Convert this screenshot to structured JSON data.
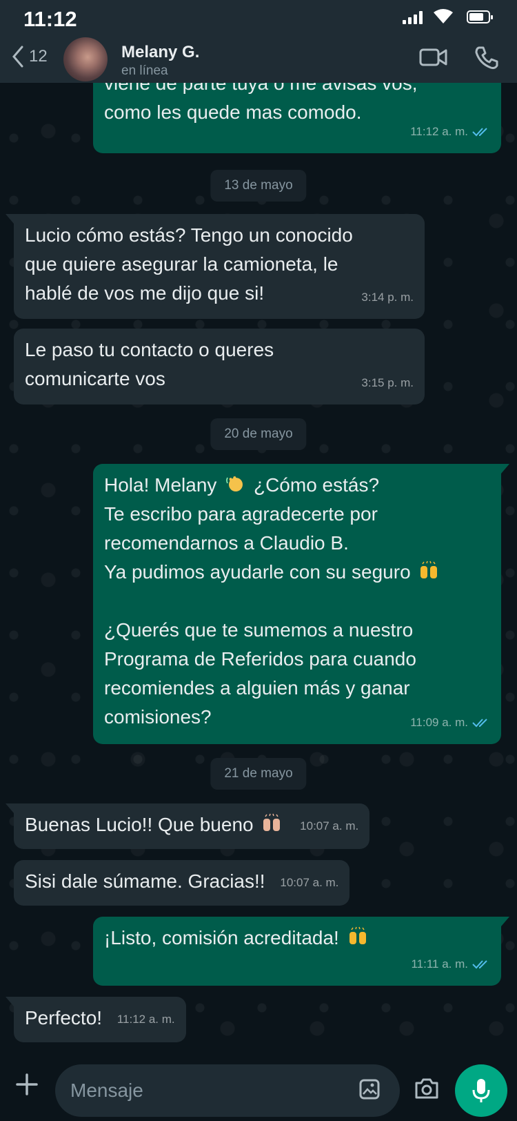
{
  "status_bar": {
    "time": "11:12"
  },
  "header": {
    "back_count": "12",
    "contact_name": "Melany G.",
    "contact_status": "en línea"
  },
  "dates": {
    "d1": "13 de mayo",
    "d2": "20 de mayo",
    "d3": "21 de mayo"
  },
  "messages": {
    "m0": {
      "lines": [
        "viene de parte tuya o me avisas vos,",
        "como les quede mas comodo."
      ],
      "time": "11:12 a. m."
    },
    "m1": {
      "lines": [
        "Lucio cómo estás? Tengo un conocido",
        "que quiere asegurar la camioneta, le",
        "hablé de vos me dijo que si!"
      ],
      "time": "3:14 p. m."
    },
    "m2": {
      "lines": [
        "Le paso tu contacto o queres",
        "comunicarte vos"
      ],
      "time": "3:15 p. m."
    },
    "m3": {
      "line1_a": "Hola! Melany",
      "line1_b": "¿Cómo estás?",
      "line2": "Te escribo para agradecerte por",
      "line3": "recomendarnos a Claudio B.",
      "line4": "Ya pudimos ayudarle con su seguro",
      "line5": "¿Querés que te sumemos a nuestro",
      "line6": "Programa de Referidos para cuando",
      "line7": "recomiendes a alguien más y ganar",
      "line8": "comisiones?",
      "time": "11:09 a. m."
    },
    "m4": {
      "text": "Buenas Lucio!! Que bueno",
      "time": "10:07 a. m."
    },
    "m5": {
      "text": "Sisi dale súmame. Gracias!!",
      "time": "10:07 a. m."
    },
    "m6": {
      "text": "¡Listo, comisión acreditada!",
      "time": "11:11 a. m."
    },
    "m7": {
      "text": "Perfecto!",
      "time": "11:12 a. m."
    }
  },
  "composer": {
    "placeholder": "Mensaje"
  },
  "colors": {
    "background": "#0b141a",
    "incoming_bubble": "#202c33",
    "outgoing_bubble": "#005c4b",
    "read_ticks": "#53bdeb",
    "accent": "#00a884"
  },
  "icons": [
    "back-chevron-icon",
    "video-call-icon",
    "phone-icon",
    "plus-icon",
    "sticker-icon",
    "camera-icon",
    "mic-icon",
    "double-check-icon",
    "waving-hand-emoji",
    "raising-hands-emoji"
  ]
}
